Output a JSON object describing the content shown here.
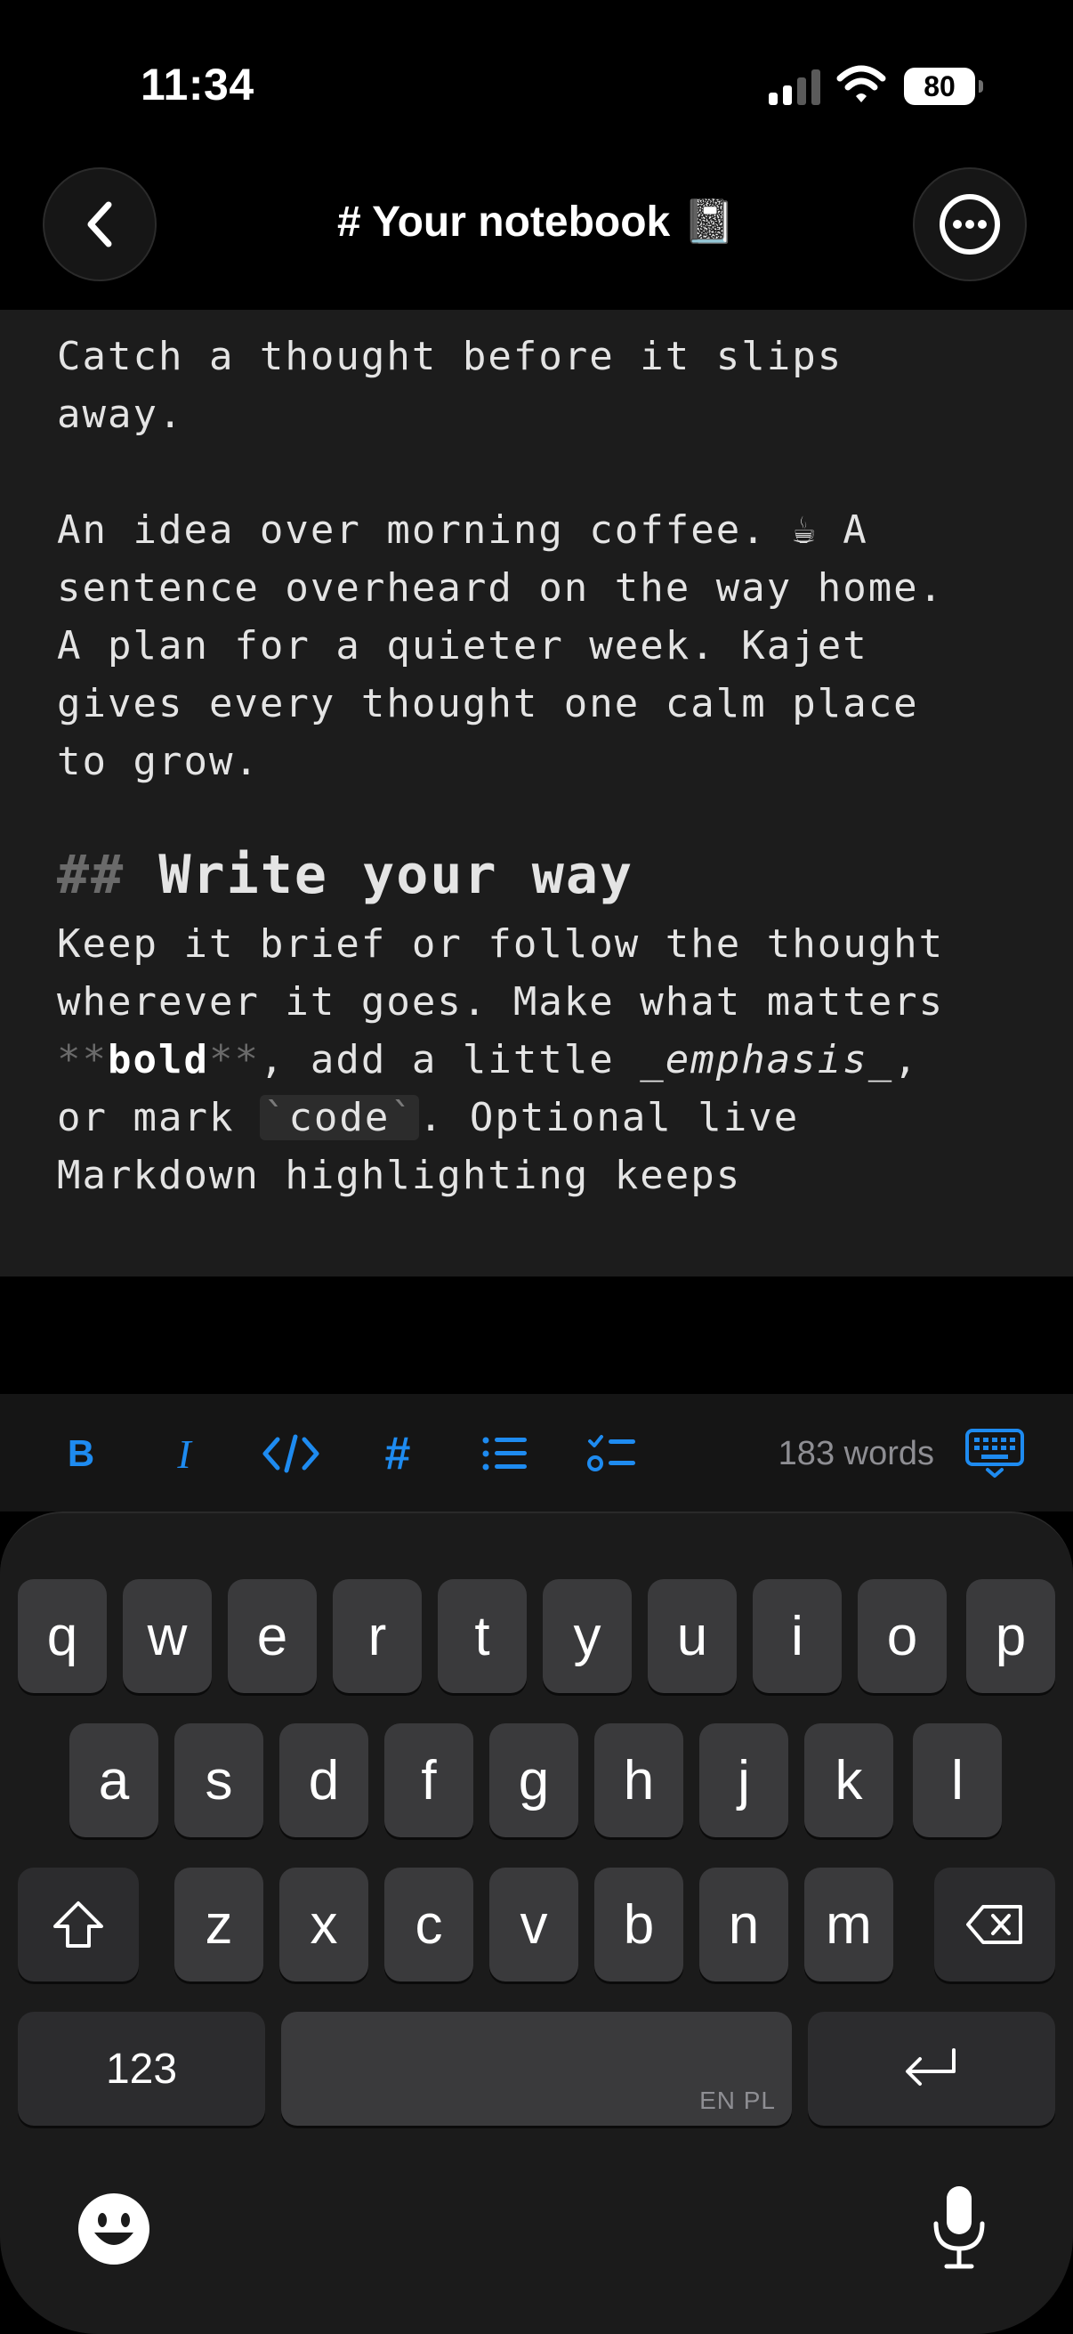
{
  "status_bar": {
    "time": "11:34",
    "battery": "80"
  },
  "header": {
    "title": "# Your notebook",
    "title_icon": "📓",
    "back_icon": "chevron-left-icon",
    "more_icon": "ellipsis-circle-icon"
  },
  "editor": {
    "p1": [
      "Catch a thought before it slips",
      "away."
    ],
    "p2": [
      "An idea over morning coffee. ☕ A",
      "sentence overheard on the way home.",
      "A plan for a quieter week. Kajet",
      "gives every thought one calm place",
      "to grow."
    ],
    "heading_marker": "##",
    "heading_text": "Write your way",
    "p3_line1": "Keep it brief or follow the thought",
    "p3_line2": "wherever it goes. Make what matters",
    "bold_marker": "**",
    "bold_word": "bold",
    "p3_line3_mid": ", add a little ",
    "em_marker": "_",
    "em_word": "emphasis",
    "p3_line3_end": ",",
    "p3_line4_start": "or mark ",
    "code_tick": "`",
    "code_word": "code",
    "p3_line4_end": ". Optional live",
    "p3_line5": "Markdown highlighting keeps"
  },
  "toolbar": {
    "bold_label": "B",
    "italic_label": "I",
    "hash_label": "#",
    "word_count": "183 words",
    "accent_color": "#1e8bf0"
  },
  "keyboard": {
    "row1": [
      "q",
      "w",
      "e",
      "r",
      "t",
      "y",
      "u",
      "i",
      "o",
      "p"
    ],
    "row2": [
      "a",
      "s",
      "d",
      "f",
      "g",
      "h",
      "j",
      "k",
      "l"
    ],
    "row3": [
      "z",
      "x",
      "c",
      "v",
      "b",
      "n",
      "m"
    ],
    "numbers_label": "123",
    "space_language": "EN PL"
  }
}
